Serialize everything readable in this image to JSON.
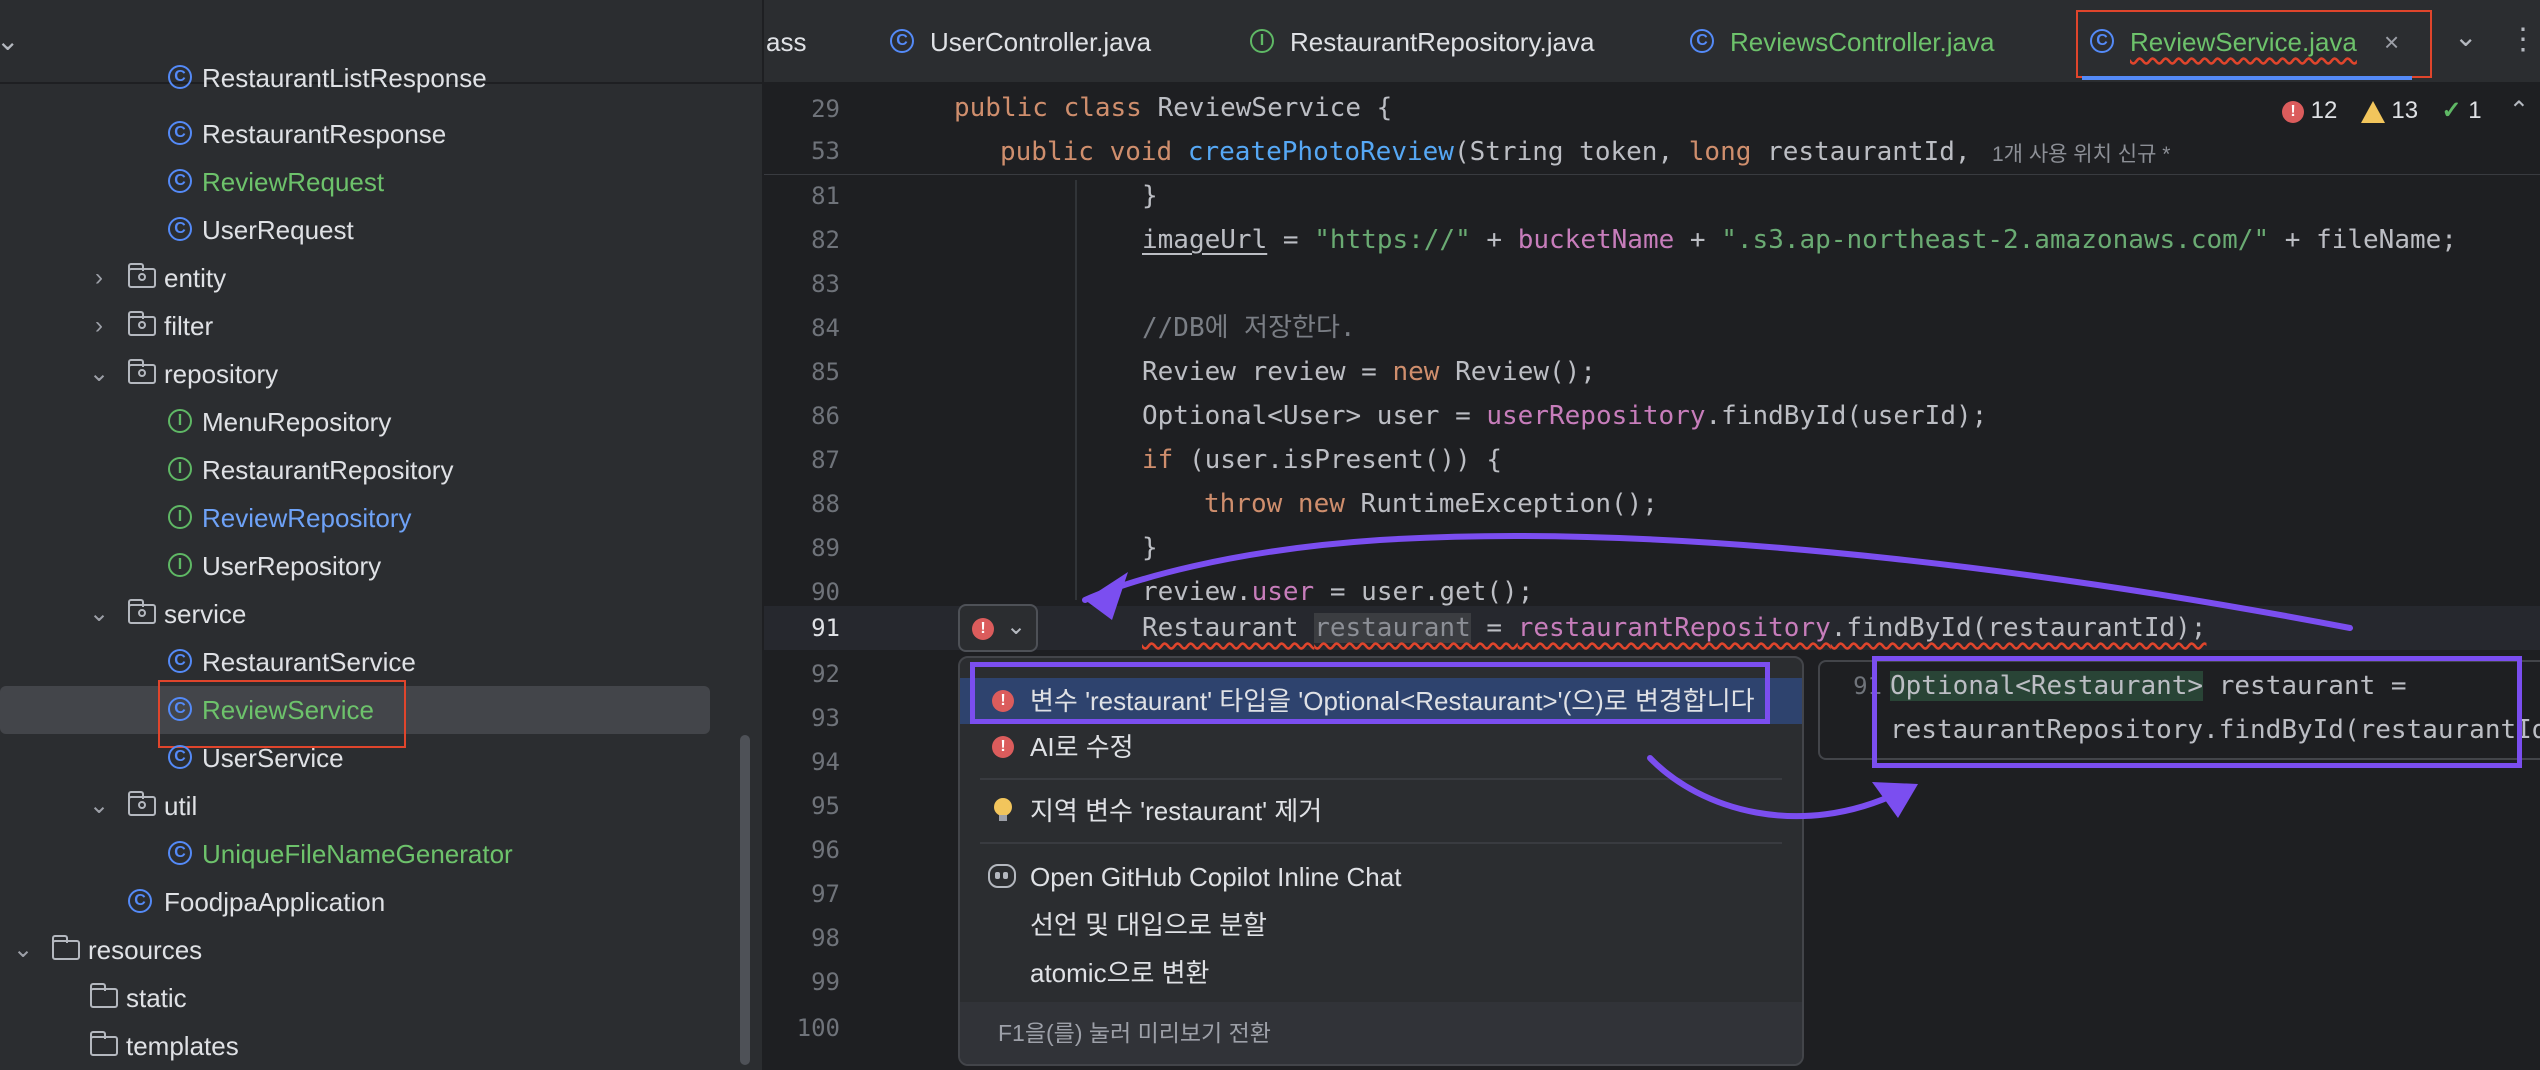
{
  "project_tree": {
    "items": [
      {
        "label": "RestaurantListResponse",
        "kind": "class"
      },
      {
        "label": "RestaurantResponse",
        "kind": "class"
      },
      {
        "label": "ReviewRequest",
        "kind": "class"
      },
      {
        "label": "UserRequest",
        "kind": "class"
      },
      {
        "label": "entity",
        "kind": "folder"
      },
      {
        "label": "filter",
        "kind": "folder"
      },
      {
        "label": "repository",
        "kind": "folder"
      },
      {
        "label": "MenuRepository",
        "kind": "interface"
      },
      {
        "label": "RestaurantRepository",
        "kind": "interface"
      },
      {
        "label": "ReviewRepository",
        "kind": "interface"
      },
      {
        "label": "UserRepository",
        "kind": "interface"
      },
      {
        "label": "service",
        "kind": "folder"
      },
      {
        "label": "RestaurantService",
        "kind": "class"
      },
      {
        "label": "ReviewService",
        "kind": "class",
        "selected": true
      },
      {
        "label": "UserService",
        "kind": "class"
      },
      {
        "label": "util",
        "kind": "folder"
      },
      {
        "label": "UniqueFileNameGenerator",
        "kind": "class"
      },
      {
        "label": "FoodjpaApplication",
        "kind": "class"
      },
      {
        "label": "resources",
        "kind": "folder"
      },
      {
        "label": "static",
        "kind": "folder"
      },
      {
        "label": "templates",
        "kind": "folder"
      }
    ]
  },
  "tabs": [
    {
      "label": "ass"
    },
    {
      "label": "UserController.java"
    },
    {
      "label": "RestaurantRepository.java"
    },
    {
      "label": "ReviewsController.java"
    },
    {
      "label": "ReviewService.java",
      "active": true
    }
  ],
  "inspections": {
    "errors": "12",
    "warnings": "13",
    "ok": "1"
  },
  "sticky_header": [
    {
      "line": "29",
      "code": "public class ReviewService {"
    },
    {
      "line": "53",
      "code": "public void createPhotoReview(String token, long restaurantId,",
      "hint": "1개 사용 위치   신규 *"
    }
  ],
  "editor": {
    "lines": [
      {
        "n": "81",
        "code": "}"
      },
      {
        "n": "82",
        "code": "imageUrl = \"https://\" + bucketName + \".s3.ap-northeast-2.amazonaws.com/\" + fileName;"
      },
      {
        "n": "83",
        "code": ""
      },
      {
        "n": "84",
        "code": "//DB에 저장한다."
      },
      {
        "n": "85",
        "code": "Review review = new Review();"
      },
      {
        "n": "86",
        "code": "Optional<User> user = userRepository.findById(userId);"
      },
      {
        "n": "87",
        "code": "if (user.isPresent()) {"
      },
      {
        "n": "88",
        "code": "throw new RuntimeException();"
      },
      {
        "n": "89",
        "code": "}"
      },
      {
        "n": "90",
        "code": "review.user = user.get();"
      },
      {
        "n": "91",
        "code": "Restaurant restaurant = restaurantRepository.findById(restaurantId);"
      },
      {
        "n": "92",
        "code": ""
      },
      {
        "n": "93",
        "code": ""
      },
      {
        "n": "94",
        "code": ""
      },
      {
        "n": "95",
        "code": ""
      },
      {
        "n": "96",
        "code": ""
      },
      {
        "n": "97",
        "code": ""
      },
      {
        "n": "98",
        "code": ""
      },
      {
        "n": "99",
        "code": ""
      },
      {
        "n": "100",
        "code": ""
      }
    ]
  },
  "popup": {
    "items": [
      {
        "label": "변수 'restaurant' 타입을 'Optional<Restaurant>'(으)로 변경합니다",
        "icon": "error-icon",
        "selected": true
      },
      {
        "label": "AI로 수정",
        "icon": "error-icon"
      },
      {
        "label": "지역 변수 'restaurant' 제거",
        "icon": "bulb-icon"
      },
      {
        "label": "Open GitHub Copilot Inline Chat",
        "icon": "copilot-icon"
      },
      {
        "label": "선언 및 대입으로 분할",
        "icon": ""
      },
      {
        "label": "atomic으로 변환",
        "icon": ""
      }
    ],
    "footer": "F1을(를) 눌러 미리보기 전환"
  },
  "preview": {
    "line": "91",
    "type_part": "Optional<Restaurant>",
    "rest1": " restaurant = ",
    "line2": "restaurantRepository.findById(restaurantId);"
  },
  "colors": {
    "annotation": "#7b4ef0",
    "highlight_box": "#e0452c",
    "accent": "#548af7"
  }
}
